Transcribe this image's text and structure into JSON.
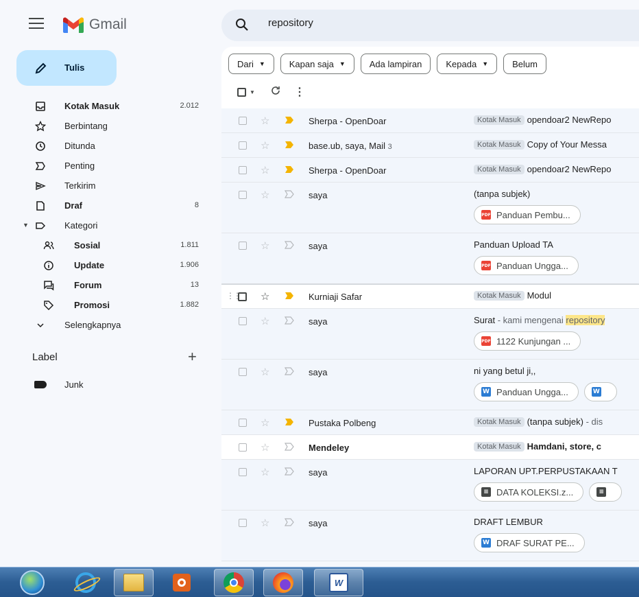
{
  "app": {
    "name": "Gmail"
  },
  "search": {
    "query": "repository"
  },
  "compose": {
    "label": "Tulis"
  },
  "nav": [
    {
      "label": "Kotak Masuk",
      "count": "2.012",
      "bold": true,
      "icon": "inbox-icon"
    },
    {
      "label": "Berbintang",
      "count": "",
      "bold": false,
      "icon": "star-icon"
    },
    {
      "label": "Ditunda",
      "count": "",
      "bold": false,
      "icon": "clock-icon"
    },
    {
      "label": "Penting",
      "count": "",
      "bold": false,
      "icon": "important-icon"
    },
    {
      "label": "Terkirim",
      "count": "",
      "bold": false,
      "icon": "send-icon"
    },
    {
      "label": "Draf",
      "count": "8",
      "bold": true,
      "icon": "draft-icon"
    },
    {
      "label": "Kategori",
      "count": "",
      "bold": false,
      "icon": "label-icon"
    }
  ],
  "categories": [
    {
      "label": "Sosial",
      "count": "1.811",
      "icon": "people-icon"
    },
    {
      "label": "Update",
      "count": "1.906",
      "icon": "info-icon"
    },
    {
      "label": "Forum",
      "count": "13",
      "icon": "forum-icon"
    },
    {
      "label": "Promosi",
      "count": "1.882",
      "icon": "tag-icon"
    }
  ],
  "more": {
    "label": "Selengkapnya"
  },
  "labels": {
    "heading": "Label",
    "items": [
      {
        "label": "Junk"
      }
    ]
  },
  "filters": [
    {
      "label": "Dari",
      "dropdown": true
    },
    {
      "label": "Kapan saja",
      "dropdown": true
    },
    {
      "label": "Ada lampiran",
      "dropdown": false
    },
    {
      "label": "Kepada",
      "dropdown": true
    },
    {
      "label": "Belum",
      "dropdown": false
    }
  ],
  "emails": [
    {
      "sender": "Sherpa - OpenDoar",
      "count": "",
      "tag": "Kotak Masuk",
      "subject": "opendoar2 NewRepo",
      "snippet": "",
      "attachments": [],
      "important": true
    },
    {
      "sender": "base.ub, saya, Mail",
      "count": "3",
      "tag": "Kotak Masuk",
      "subject": "Copy of Your Messa",
      "snippet": "",
      "attachments": [],
      "important": true
    },
    {
      "sender": "Sherpa - OpenDoar",
      "count": "",
      "tag": "Kotak Masuk",
      "subject": "opendoar2 NewRepo",
      "snippet": "",
      "attachments": [],
      "important": true
    },
    {
      "sender": "saya",
      "count": "",
      "tag": "",
      "subject": "(tanpa subjek)",
      "snippet": "",
      "attachments": [
        {
          "type": "pdf",
          "name": "Panduan Pembu..."
        }
      ],
      "important": false
    },
    {
      "sender": "saya",
      "count": "",
      "tag": "",
      "subject": "Panduan Upload TA",
      "snippet": "",
      "attachments": [
        {
          "type": "pdf",
          "name": "Panduan Ungga..."
        }
      ],
      "important": false
    },
    {
      "sender": "Kurniaji Safar",
      "count": "",
      "tag": "Kotak Masuk",
      "subject": "Modul",
      "snippet": "",
      "attachments": [],
      "important": true,
      "hovered": true
    },
    {
      "sender": "saya",
      "count": "",
      "tag": "",
      "subject": "Surat",
      "snippet": " - kami mengenai ",
      "highlight": "repository",
      "attachments": [
        {
          "type": "pdf",
          "name": "1122 Kunjungan ..."
        }
      ],
      "important": false
    },
    {
      "sender": "saya",
      "count": "",
      "tag": "",
      "subject": "ni yang betul ji,,",
      "snippet": "",
      "attachments": [
        {
          "type": "word",
          "name": "Panduan Ungga..."
        },
        {
          "type": "word",
          "name": ""
        }
      ],
      "important": false
    },
    {
      "sender": "Pustaka Polbeng",
      "count": "",
      "tag": "Kotak Masuk",
      "subject": "(tanpa subjek)",
      "snippet": " - dis",
      "attachments": [],
      "important": true
    },
    {
      "sender": "Mendeley",
      "count": "",
      "tag": "Kotak Masuk",
      "subject": "Hamdani, store, c",
      "snippet": "",
      "attachments": [],
      "important": false,
      "unread": true
    },
    {
      "sender": "saya",
      "count": "",
      "tag": "",
      "subject": "LAPORAN UPT.PERPUSTAKAAN T",
      "snippet": "",
      "attachments": [
        {
          "type": "doc",
          "name": "DATA KOLEKSI.z..."
        },
        {
          "type": "doc",
          "name": ""
        }
      ],
      "important": false
    },
    {
      "sender": "saya",
      "count": "",
      "tag": "",
      "subject": "DRAFT LEMBUR",
      "snippet": "",
      "attachments": [
        {
          "type": "word",
          "name": "DRAF SURAT PE..."
        }
      ],
      "important": false
    }
  ],
  "taskbar": [
    {
      "name": "start-button"
    },
    {
      "name": "internet-explorer"
    },
    {
      "name": "file-explorer"
    },
    {
      "name": "vlc-player"
    },
    {
      "name": "chrome"
    },
    {
      "name": "firefox"
    },
    {
      "name": "word"
    }
  ],
  "colors": {
    "compose_bg": "#c2e7ff",
    "accent": "#0b57d0",
    "important": "#f4b400",
    "highlight": "#fde68a"
  }
}
